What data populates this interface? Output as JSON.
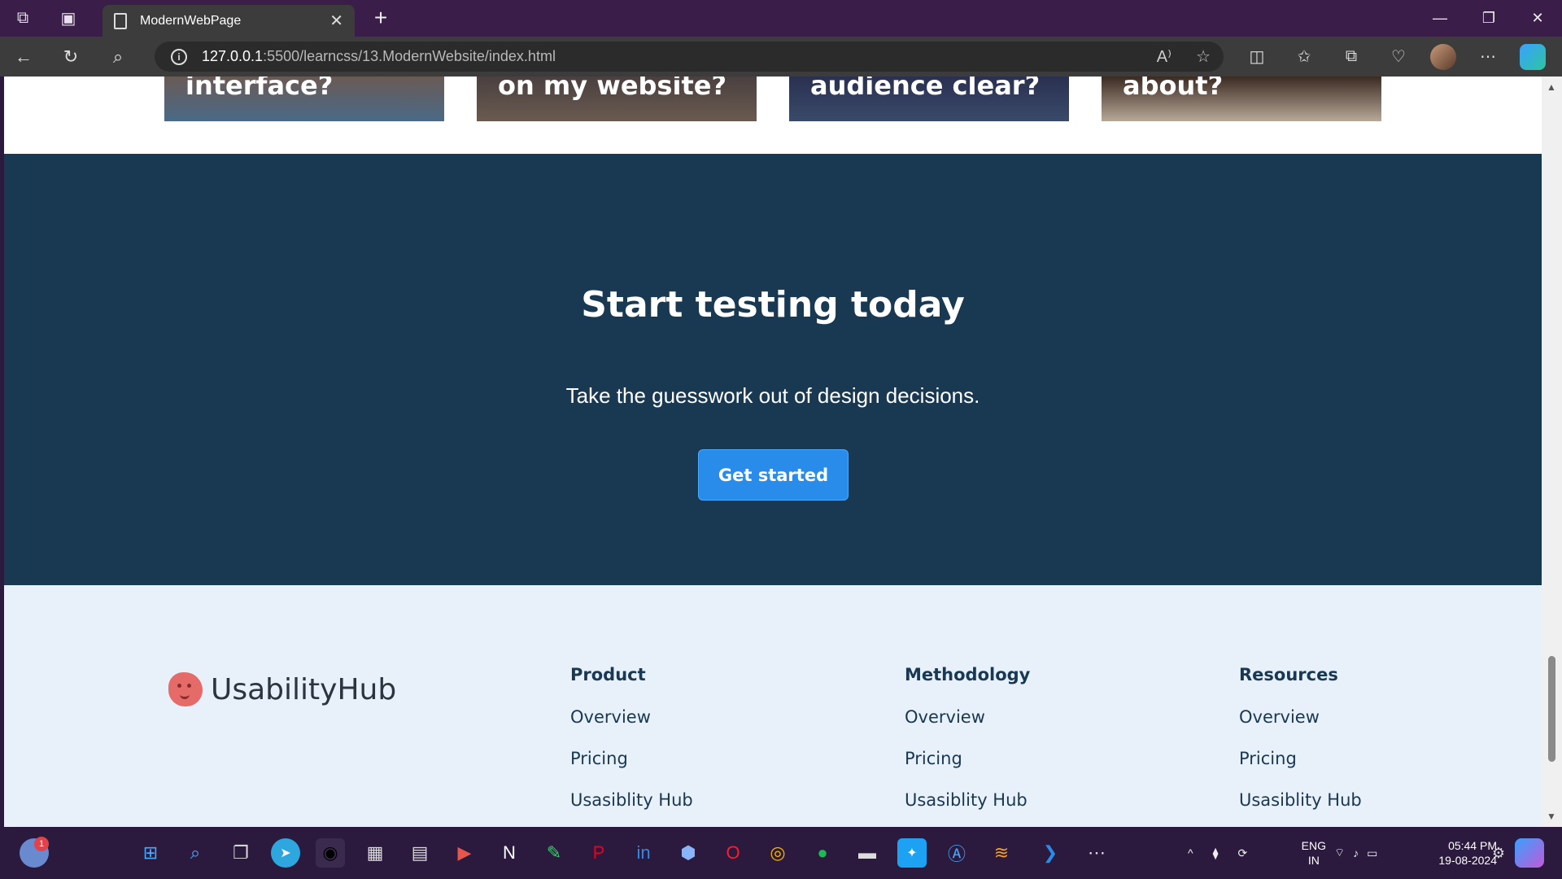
{
  "browser": {
    "tab_title": "ModernWebPage",
    "url_host": "127.0.0.1",
    "url_path": ":5500/learncss/13.ModernWebsite/index.html"
  },
  "cards": [
    {
      "heading": "interface?"
    },
    {
      "heading": "on my website?"
    },
    {
      "heading": "audience clear?"
    },
    {
      "heading": "about?"
    }
  ],
  "cta": {
    "title": "Start testing today",
    "subtitle": "Take the guesswork out of design decisions.",
    "button": "Get started"
  },
  "footer": {
    "brand": "UsabilityHub",
    "columns": [
      {
        "heading": "Product",
        "links": [
          "Overview",
          "Pricing",
          "Usasiblity Hub"
        ]
      },
      {
        "heading": "Methodology",
        "links": [
          "Overview",
          "Pricing",
          "Usasiblity Hub"
        ]
      },
      {
        "heading": "Resources",
        "links": [
          "Overview",
          "Pricing",
          "Usasiblity Hub"
        ]
      }
    ]
  },
  "taskbar": {
    "notification_count": "1",
    "lang_top": "ENG",
    "lang_bottom": "IN",
    "time": "05:44 PM",
    "date": "19-08-2024"
  },
  "colors": {
    "cta_bg": "#193852",
    "button": "#2a8cea",
    "footer_bg": "#e8f0f9",
    "brand_logo": "#e46b68"
  }
}
